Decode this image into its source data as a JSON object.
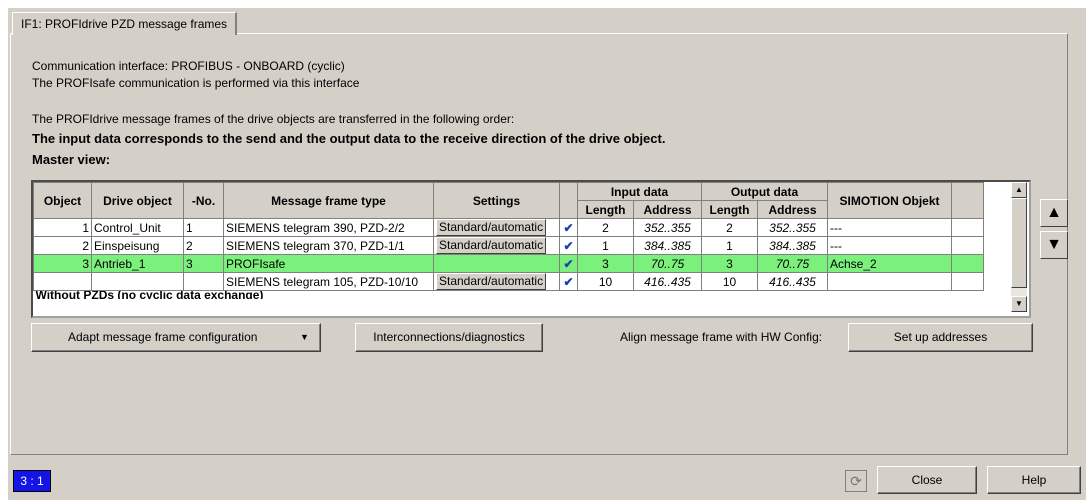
{
  "tab": {
    "label": "IF1:  PROFIdrive  PZD message frames"
  },
  "info": {
    "line1": "Communication interface: PROFIBUS - ONBOARD (cyclic)",
    "line2": "The PROFIsafe communication is performed via this interface",
    "line3": "The PROFIdrive message frames of the drive objects are transferred in the following order:",
    "line4": "The input data corresponds to the send and the output data to the receive direction of the drive object.",
    "master_view": "Master view:"
  },
  "grid": {
    "headers": {
      "object": "Object",
      "drive_object": "Drive object",
      "no": "-No.",
      "frame_type": "Message frame type",
      "settings": "Settings",
      "input": "Input data",
      "output": "Output data",
      "simotion": "SIMOTION Objekt",
      "length": "Length",
      "address": "Address"
    },
    "rows": [
      {
        "object": "1",
        "drive": "Control_Unit",
        "no": "1",
        "type": "SIEMENS telegram 390, PZD-2/2",
        "settings": "Standard/automatic",
        "check": "✔",
        "in_len": "2",
        "in_addr": "352..355",
        "out_len": "2",
        "out_addr": "352..355",
        "simotion": "---"
      },
      {
        "object": "2",
        "drive": "Einspeisung",
        "no": "2",
        "type": "SIEMENS telegram 370, PZD-1/1",
        "settings": "Standard/automatic",
        "check": "✔",
        "in_len": "1",
        "in_addr": "384..385",
        "out_len": "1",
        "out_addr": "384..385",
        "simotion": "---"
      },
      {
        "object": "3",
        "drive": "Antrieb_1",
        "no": "3",
        "type": "PROFIsafe",
        "settings": "",
        "check": "✔",
        "in_len": "3",
        "in_addr": "70..75",
        "out_len": "3",
        "out_addr": "70..75",
        "simotion": "Achse_2"
      },
      {
        "object": "",
        "drive": "",
        "no": "",
        "type": "SIEMENS telegram 105, PZD-10/10",
        "settings": "Standard/automatic",
        "check": "✔",
        "in_len": "10",
        "in_addr": "416..435",
        "out_len": "10",
        "out_addr": "416..435",
        "simotion": ""
      }
    ],
    "partial_row": "Without PZDs (no cyclic data exchange)"
  },
  "buttons": {
    "adapt": "Adapt message frame configuration",
    "interconnections": "Interconnections/diagnostics",
    "align_label": "Align message frame with HW Config:",
    "setup": "Set up addresses",
    "close": "Close",
    "help": "Help"
  },
  "status": {
    "badge": "3 : 1"
  }
}
